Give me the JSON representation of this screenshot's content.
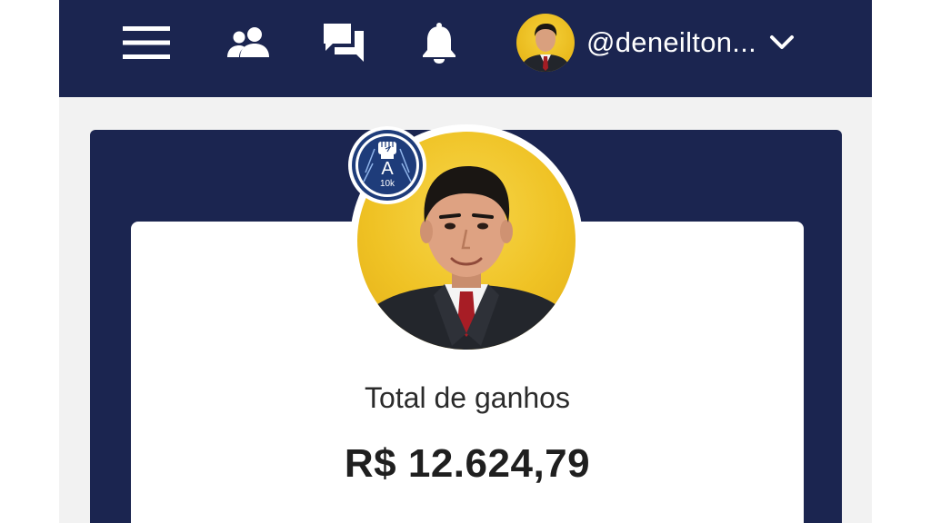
{
  "header": {
    "icons": {
      "menu": "menu-icon",
      "friends": "friends-icon",
      "chat": "chat-icon",
      "notifications": "bell-icon",
      "dropdown": "chevron-down-icon"
    },
    "username": "@deneilton...",
    "avatar": "user-avatar"
  },
  "profile": {
    "avatar": "profile-photo",
    "badge": {
      "letter": "A",
      "level": "10k"
    },
    "earnings_label": "Total de ganhos",
    "earnings_value": "R$ 12.624,79"
  },
  "colors": {
    "navy": "#1b2550",
    "gold": "#efc224",
    "badge_blue": "#1e3c7a",
    "background": "#f2f2f2",
    "card": "#ffffff"
  }
}
